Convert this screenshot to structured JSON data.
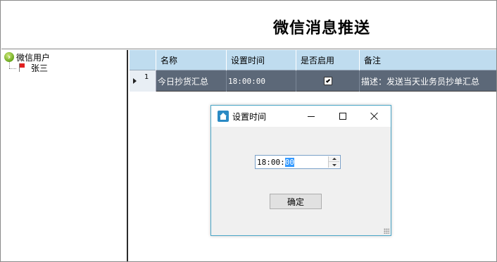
{
  "header": {
    "title": "微信消息推送"
  },
  "tree": {
    "root_label": "微信用户",
    "children": [
      {
        "label": "张三"
      }
    ]
  },
  "grid": {
    "columns": [
      "名称",
      "设置时间",
      "是否启用",
      "备注"
    ],
    "rows": [
      {
        "row_number": "1",
        "name": "今日抄货汇总",
        "time": "18:00:00",
        "enabled": true,
        "note": "描述：发送当天业务员抄单汇总"
      }
    ]
  },
  "dialog": {
    "title": "设置时间",
    "time_value_prefix": "18:00:",
    "time_value_selected": "00",
    "ok_label": "确定"
  },
  "colors": {
    "header_bg": "#bfdcef",
    "selected_row_bg": "#5c6878",
    "dialog_border": "#4aa6c8",
    "selection_blue": "#3399ff"
  },
  "icons": {
    "tree_root": "user-group-icon",
    "tree_child": "flag-icon",
    "dialog": "home-icon"
  }
}
